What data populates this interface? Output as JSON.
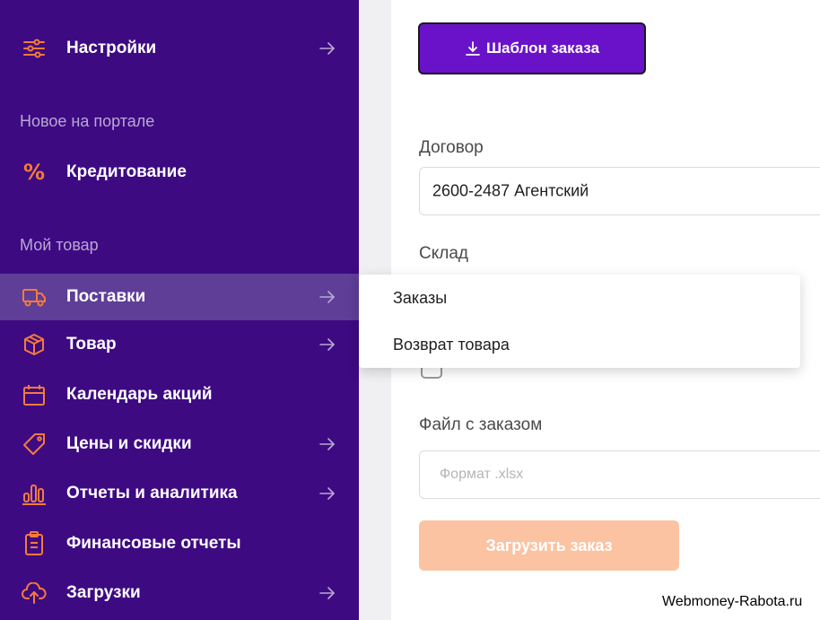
{
  "sidebar": {
    "settings_label": "Настройки",
    "section_new": "Новое на портале",
    "credit_label": "Кредитование",
    "section_goods": "Мой товар",
    "items": [
      {
        "label": "Поставки",
        "icon": "truck-icon",
        "has_arrow": true,
        "active": true
      },
      {
        "label": "Товар",
        "icon": "box-icon",
        "has_arrow": true,
        "active": false
      },
      {
        "label": "Календарь акций",
        "icon": "calendar-icon",
        "has_arrow": false,
        "active": false
      },
      {
        "label": "Цены и скидки",
        "icon": "tag-icon",
        "has_arrow": true,
        "active": false
      },
      {
        "label": "Отчеты и аналитика",
        "icon": "bar-chart-icon",
        "has_arrow": true,
        "active": false
      },
      {
        "label": "Финансовые отчеты",
        "icon": "clipboard-icon",
        "has_arrow": false,
        "active": false
      },
      {
        "label": "Загрузки",
        "icon": "cloud-upload-icon",
        "has_arrow": true,
        "active": false
      }
    ]
  },
  "main": {
    "template_button": "Шаблон заказа",
    "contract_label": "Договор",
    "contract_value": "2600-2487 Агентский",
    "warehouse_label": "Склад",
    "file_label": "Файл с заказом",
    "file_placeholder": "Формат .xlsx",
    "upload_button": "Загрузить заказ"
  },
  "dropdown": {
    "items": [
      "Заказы",
      "Возврат товара"
    ]
  },
  "watermark": "Webmoney-Rabota.ru",
  "colors": {
    "sidebar_bg": "#3d0a82",
    "sidebar_active": "#5e3e97",
    "accent_orange": "#f47b3b",
    "primary_button": "#6a12c9",
    "disabled_button": "#fbc3a1"
  }
}
